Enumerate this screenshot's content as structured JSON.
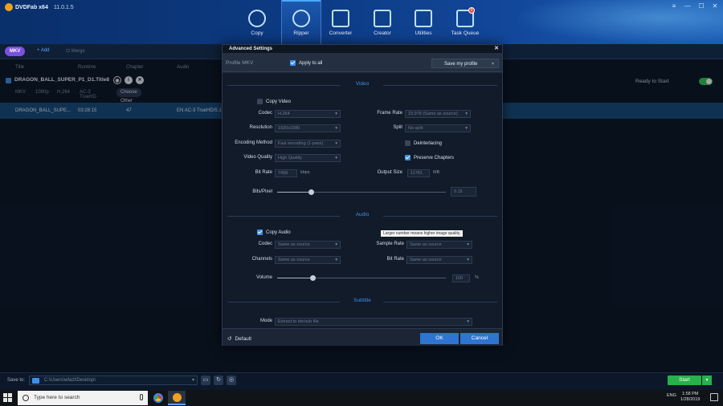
{
  "app": {
    "name": "DVDFab x64",
    "version": "11.0.1.5"
  },
  "nav": [
    {
      "label": "Copy",
      "icon": "disc-copy-icon"
    },
    {
      "label": "Ripper",
      "icon": "disc-ripper-icon",
      "active": true
    },
    {
      "label": "Converter",
      "icon": "film-converter-icon"
    },
    {
      "label": "Creator",
      "icon": "film-creator-icon"
    },
    {
      "label": "Utilities",
      "icon": "utilities-icon"
    },
    {
      "label": "Task Queue",
      "icon": "task-queue-icon",
      "badge": "0"
    }
  ],
  "window_controls": {
    "menu": "≡",
    "minimize": "—",
    "maximize": "☐",
    "close": "✕"
  },
  "toolbar": {
    "format": "MKV",
    "add": "+ Add",
    "merge": "⊡ Merge"
  },
  "list_headers": {
    "title": "Title",
    "runtime": "Runtime",
    "chapter": "Chapter",
    "audio": "Audio"
  },
  "title_item": {
    "name": "DRAGON_BALL_SUPER_P1_D1.Title8",
    "format": "MKV",
    "resolution": "1080p",
    "video_codec": "H.264",
    "audio_codec": "AC-3 TrueHD",
    "choose_button": "Choose Other Titles",
    "status": "Ready to Start"
  },
  "track_row": {
    "title": "DRAGON_BALL_SUPE...",
    "runtime": "03:28:15",
    "chapter": "47",
    "audio": "EN AC-3 TrueHD/5.1"
  },
  "bottom": {
    "save_to": "Save to:",
    "path": "C:\\Users\\wfazl\\Desktop\\",
    "start": "Start",
    "start_dropdown": "▾"
  },
  "modal": {
    "title": "Advanced Settings",
    "close": "✕",
    "profile_label": "Profile  MKV",
    "apply_to_all": "Apply to all",
    "save_profile": "Save my profile",
    "video": {
      "section": "Video",
      "copy_video": "Copy Video",
      "codec_label": "Codec",
      "codec": "H.264",
      "resolution_label": "Resolution",
      "resolution": "1920x1080",
      "encoding_label": "Encoding Method",
      "encoding": "Fast encoding (1-pass)",
      "quality_label": "Video Quality",
      "quality": "High Quality",
      "bitrate_label": "Bit Rate",
      "bitrate": "7458",
      "bitrate_unit": "kbps",
      "framerate_label": "Frame Rate",
      "framerate": "23.976 (Same as source)",
      "split_label": "Split",
      "split": "No split",
      "deinterlacing": "Deinterlacing",
      "preserve_chapters": "Preserve Chapters",
      "output_size_label": "Output Size",
      "output_size": "11781",
      "output_size_unit": "MB",
      "bits_pixel_label": "Bits/Pixel",
      "bits_pixel": "0.15",
      "bits_pixel_fraction": 0.2,
      "tooltip": "Larger number means higher image quality."
    },
    "audio": {
      "section": "Audio",
      "copy_audio": "Copy Audio",
      "codec_label": "Codec",
      "codec": "Same as source",
      "channels_label": "Channels",
      "channels": "Same as source",
      "sample_rate_label": "Sample Rate",
      "sample_rate": "Same as source",
      "bitrate_label": "Bit Rate",
      "bitrate": "Same as source",
      "volume_label": "Volume",
      "volume": "100",
      "volume_unit": "%",
      "volume_fraction": 0.21
    },
    "subtitle": {
      "section": "Subtitle",
      "mode_label": "Mode",
      "mode": "Extract to idx/sub file"
    },
    "default_button": "Default",
    "ok_button": "OK",
    "cancel_button": "Cancel"
  },
  "taskbar": {
    "search_placeholder": "Type here to search",
    "lang": "ENG",
    "time": "1:58 PM",
    "date": "1/28/2019"
  }
}
